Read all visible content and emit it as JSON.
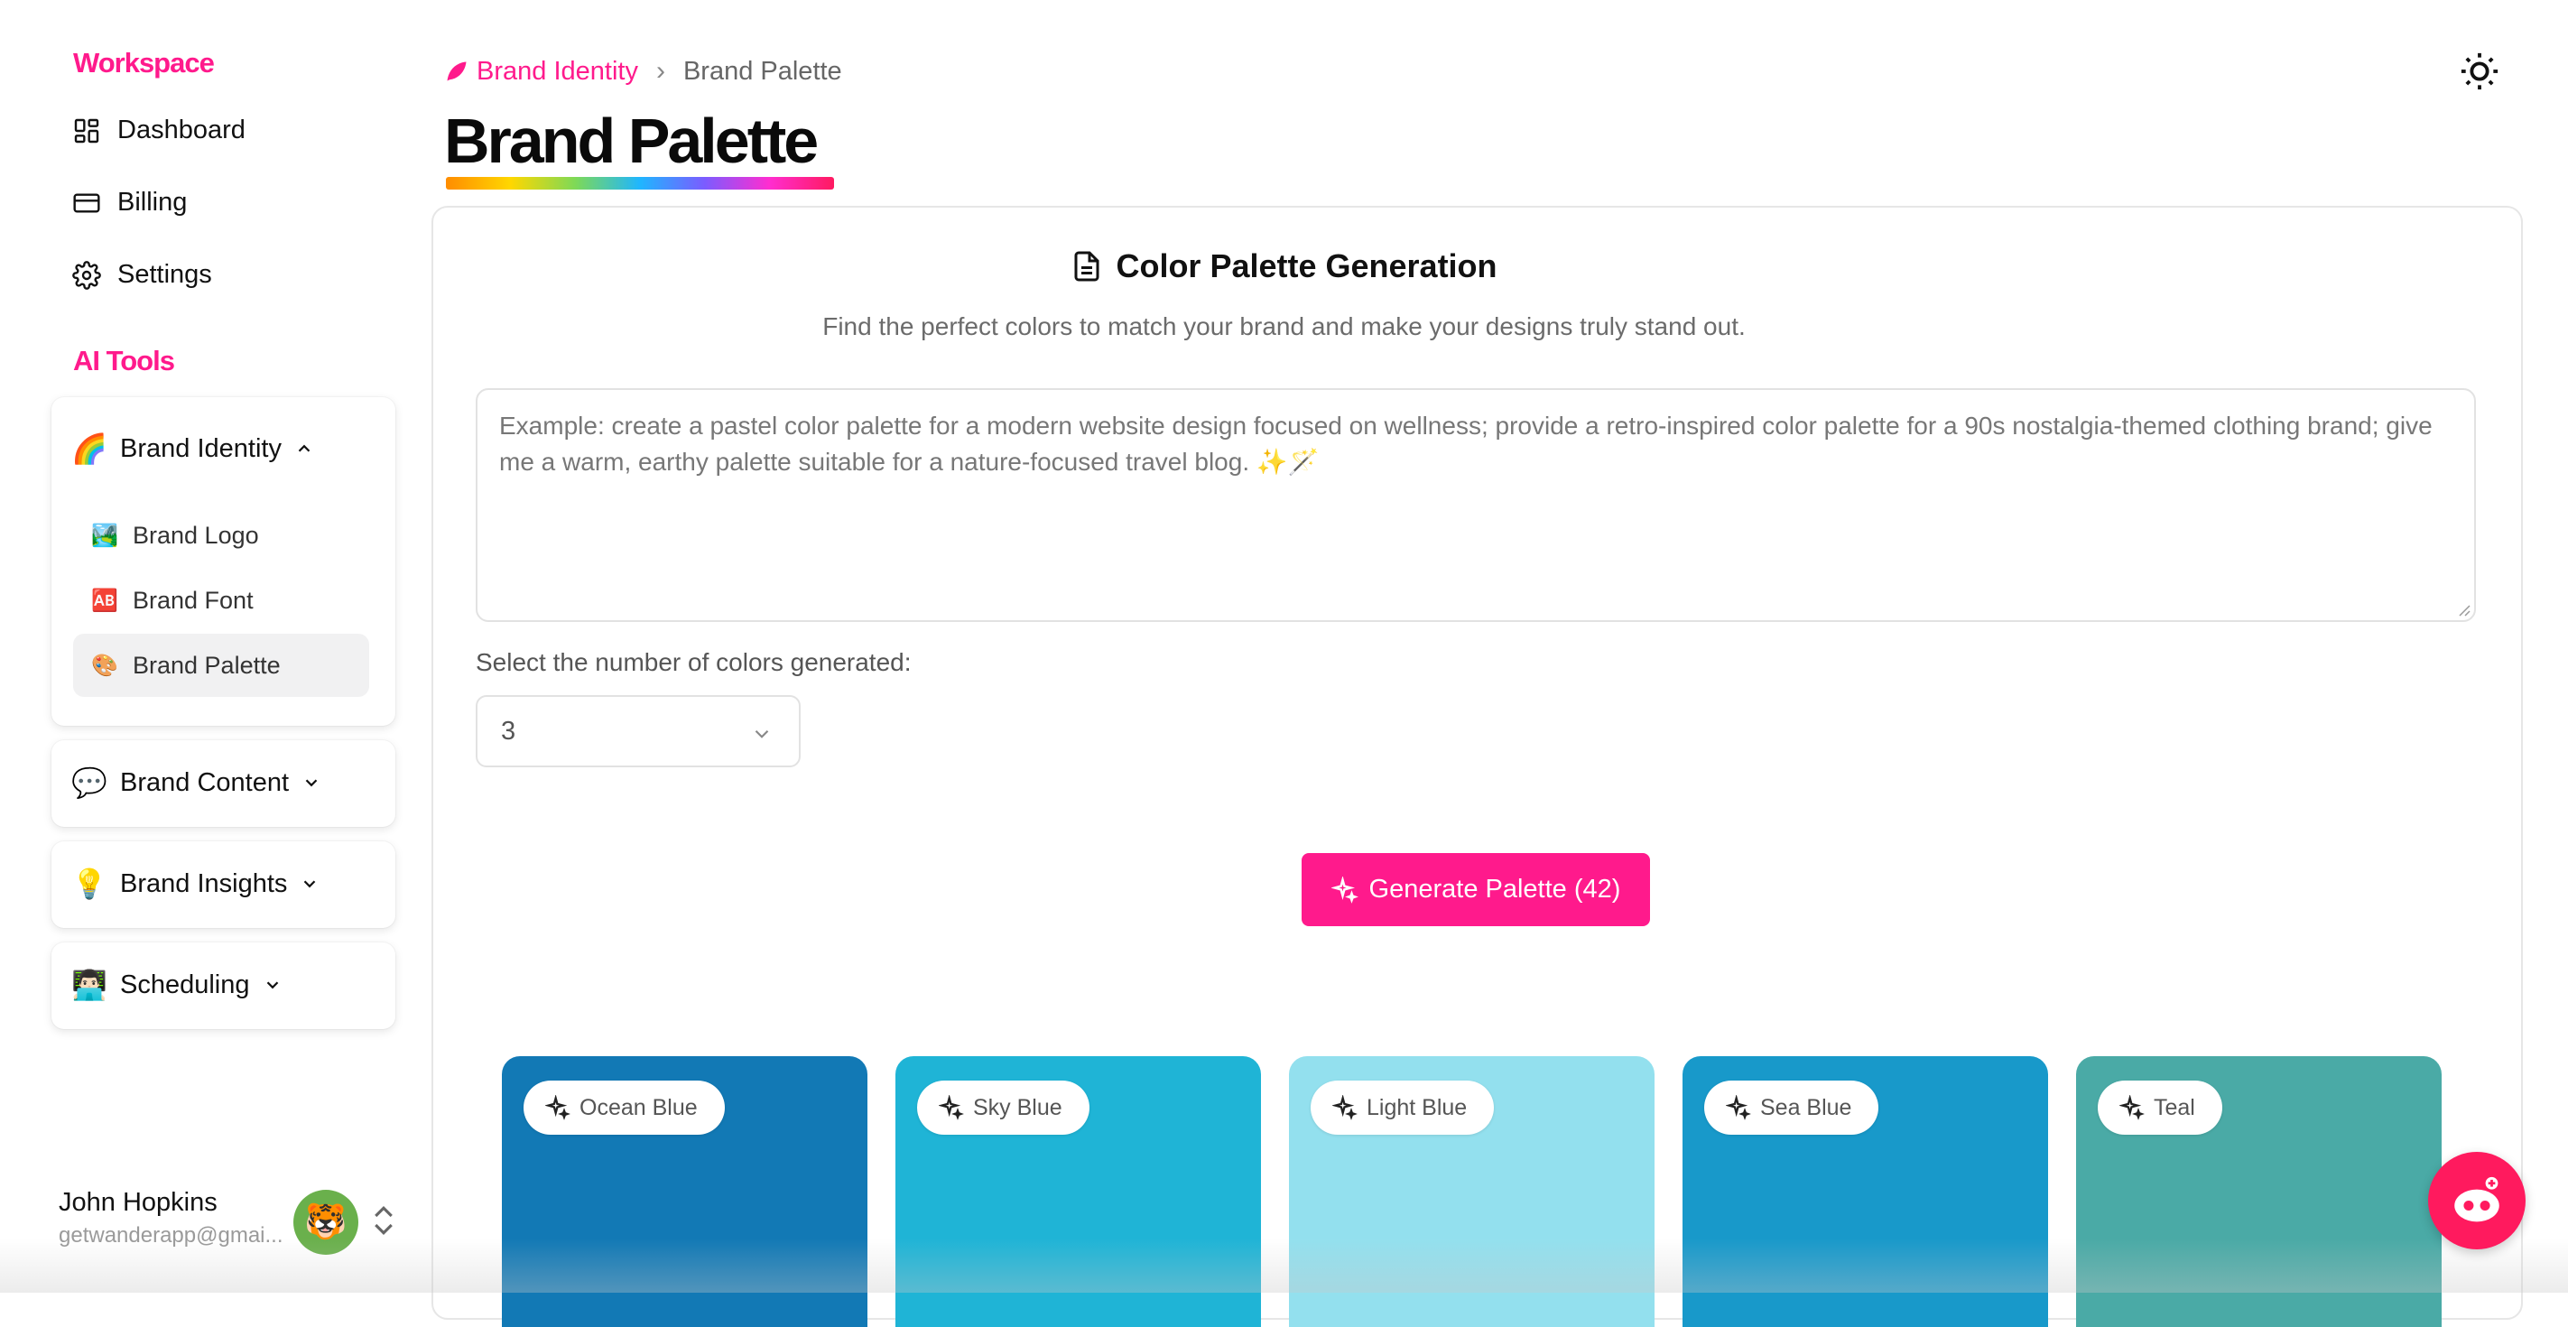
{
  "sidebar": {
    "workspace_title": "Workspace",
    "workspace_items": [
      {
        "label": "Dashboard",
        "icon": "dashboard-icon"
      },
      {
        "label": "Billing",
        "icon": "credit-card-icon"
      },
      {
        "label": "Settings",
        "icon": "gear-icon"
      }
    ],
    "ai_tools_title": "AI Tools",
    "groups": [
      {
        "emoji": "🌈",
        "label": "Brand Identity",
        "expanded": true,
        "items": [
          {
            "emoji": "🏞️",
            "label": "Brand Logo"
          },
          {
            "emoji": "🆎",
            "label": "Brand Font"
          },
          {
            "emoji": "🎨",
            "label": "Brand Palette",
            "active": true
          }
        ]
      },
      {
        "emoji": "💬",
        "label": "Brand Content",
        "expanded": false
      },
      {
        "emoji": "💡",
        "label": "Brand Insights",
        "expanded": false
      },
      {
        "emoji": "👨🏻‍💻",
        "label": "Scheduling",
        "expanded": false
      }
    ],
    "user": {
      "name": "John Hopkins",
      "email": "getwanderapp@gmai..."
    }
  },
  "header": {
    "breadcrumb_parent": "Brand Identity",
    "breadcrumb_current": "Brand Palette",
    "page_title": "Brand Palette"
  },
  "card": {
    "title": "Color Palette Generation",
    "subtitle": "Find the perfect colors to match your brand and make your designs truly stand out.",
    "prompt_placeholder": "Example: create a pastel color palette for a modern website design focused on wellness; provide a retro-inspired color palette for a 90s nostalgia-themed clothing brand; give me a warm, earthy palette suitable for a nature-focused travel blog. ✨🪄",
    "select_label": "Select the number of colors generated:",
    "select_value": "3",
    "generate_label": "Generate Palette (42)"
  },
  "palette": [
    {
      "name": "Ocean Blue",
      "color": "#1279b5"
    },
    {
      "name": "Sky Blue",
      "color": "#1fb4d6"
    },
    {
      "name": "Light Blue",
      "color": "#93e0ee"
    },
    {
      "name": "Sea Blue",
      "color": "#1899ca"
    },
    {
      "name": "Teal",
      "color": "#4aaaa6"
    }
  ],
  "colors": {
    "accent": "#ff1a8c",
    "bot": "#ff1a5e"
  }
}
